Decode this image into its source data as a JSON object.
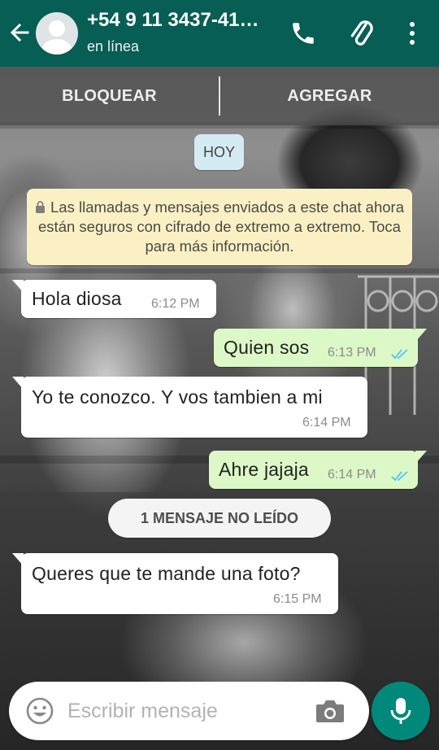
{
  "header": {
    "contact_name": "+54 9 11 3437-41…",
    "status": "en línea",
    "icons": [
      "back-arrow-icon",
      "avatar-icon",
      "call-icon",
      "attach-icon",
      "more-vert-icon"
    ]
  },
  "actions": {
    "block_label": "BLOQUEAR",
    "add_label": "AGREGAR"
  },
  "chat": {
    "date_chip": "HOY",
    "encryption_notice": "Las llamadas y mensajes enviados a este chat ahora están seguros con cifrado de extremo a extremo. Toca para más información.",
    "messages": [
      {
        "direction": "in",
        "text": "Hola diosa",
        "time": "6:12 PM"
      },
      {
        "direction": "out",
        "text": "Quien sos",
        "time": "6:13 PM",
        "status": "read"
      },
      {
        "direction": "in",
        "text": "Yo te conozco. Y vos tambien a mi",
        "time": "6:14 PM"
      },
      {
        "direction": "out",
        "text": "Ahre jajaja",
        "time": "6:14 PM",
        "status": "read"
      },
      {
        "direction": "in",
        "text": "Queres que te mande una foto?",
        "time": "6:15 PM"
      }
    ],
    "unread_label": "1 MENSAJE NO LEÍDO"
  },
  "composer": {
    "placeholder": "Escribir mensaje"
  },
  "colors": {
    "header": "#075e54",
    "outgoing_bubble": "#dcf8c6",
    "incoming_bubble": "#ffffff",
    "mic_button": "#00897b",
    "read_ticks": "#4fc3f7"
  }
}
